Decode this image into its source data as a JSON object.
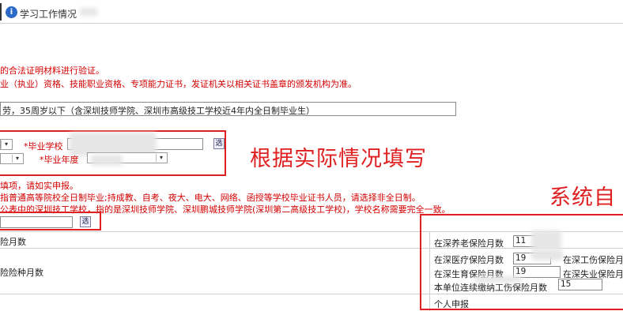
{
  "header": {
    "title": "学习工作情况"
  },
  "notices": {
    "line1": "的合法证明材料进行验证。",
    "line2": "业（执业）资格、技能职业资格、专项能力证书，发证机关以相关证书盖章的颁发机构为准。"
  },
  "criteria": {
    "text": "劳，35周岁以下（含深圳技师学院、深圳市高级技工学校近4年内全日制毕业生）"
  },
  "graduation": {
    "school_label": "*毕业学校",
    "year_label": "*毕业年度",
    "school_pick": "选",
    "annotation": "根据实际情况填写"
  },
  "instructions": {
    "line1": "填项，请如实申报。",
    "line2": "指普通高等院校全日制毕业;持成教、自考、夜大、电大、网络、函授等学校毕业证书人员，请选择非全日制。",
    "line3": "公表中的深圳技工学校，指的是深圳技师学院、深圳鹏城技师学院(深圳第二高级技工学校)，学校名称需要完全一致。"
  },
  "tech_school": {
    "pick": "选"
  },
  "insurance": {
    "annotation": "系统自",
    "months_label": "险月数",
    "type_months_label": "险险种月数",
    "pension_label": "在深养老保险月数",
    "pension_value": "11",
    "medical_label": "在深医疗保险月数",
    "medical_value": "19",
    "injury_label": "在深工伤保险月",
    "maternity_label": "在深生育保险月数",
    "maternity_value": "19",
    "unemployment_label": "在深失业保险月",
    "unit_months_label": "本单位连续缴纳工伤保险月数",
    "unit_months_value": "15",
    "personal_declare": "个人申报"
  }
}
